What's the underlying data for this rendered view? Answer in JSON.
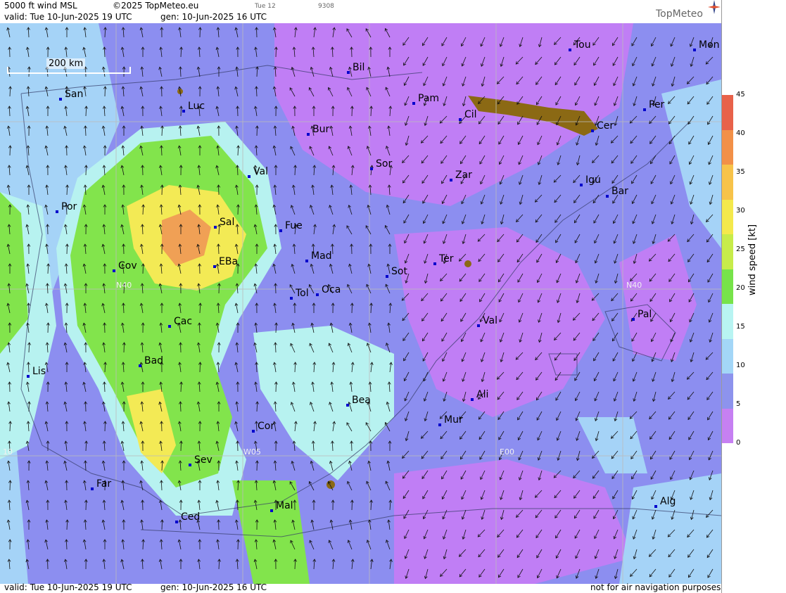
{
  "header": {
    "product": "5000 ft wind MSL",
    "copyright": "©2025 TopMeteo.eu",
    "valid": "valid:  Tue  10-Jun-2025  19 UTC",
    "gen": "gen: 10-Jun-2025 16 UTC",
    "day_tag": "Tue 12",
    "code": "9308",
    "logo": "TopMeteo"
  },
  "footer": {
    "valid": "valid:  Tue  10-Jun-2025  19 UTC",
    "gen": "gen: 10-Jun-2025 16 UTC",
    "disclaimer": "not for air navigation purposes"
  },
  "scale": {
    "label": "200 km"
  },
  "grid_labels": {
    "n40_west": "N40",
    "n40_east": "N40",
    "w05": "W05",
    "e00": "E00",
    "w10": "10"
  },
  "cities": [
    {
      "name": "San"
    },
    {
      "name": "Luc"
    },
    {
      "name": "Bil"
    },
    {
      "name": "Pam"
    },
    {
      "name": "Cil"
    },
    {
      "name": "Tou"
    },
    {
      "name": "Mon"
    },
    {
      "name": "Per"
    },
    {
      "name": "Cer"
    },
    {
      "name": "Bur"
    },
    {
      "name": "Sor"
    },
    {
      "name": "Zar"
    },
    {
      "name": "Igu"
    },
    {
      "name": "Bar"
    },
    {
      "name": "Val"
    },
    {
      "name": "Por"
    },
    {
      "name": "Sal"
    },
    {
      "name": "Fue"
    },
    {
      "name": "Cov"
    },
    {
      "name": "EBa"
    },
    {
      "name": "Mad"
    },
    {
      "name": "Sot"
    },
    {
      "name": "Ter"
    },
    {
      "name": "Tol"
    },
    {
      "name": "Oca"
    },
    {
      "name": "Pal"
    },
    {
      "name": "Cac"
    },
    {
      "name": "Val"
    },
    {
      "name": "Bad"
    },
    {
      "name": "Lis"
    },
    {
      "name": "Bea"
    },
    {
      "name": "Ali"
    },
    {
      "name": "Mur"
    },
    {
      "name": "Cor"
    },
    {
      "name": "Sev"
    },
    {
      "name": "Far"
    },
    {
      "name": "Mal"
    },
    {
      "name": "Alg"
    },
    {
      "name": "Ced"
    }
  ],
  "legend": {
    "unit": "wind speed [kt]",
    "ticks": [
      "45",
      "40",
      "35",
      "30",
      "25",
      "20",
      "15",
      "10",
      "5",
      "0"
    ],
    "colors": [
      "#e8624a",
      "#f29048",
      "#f7c34a",
      "#f4e94c",
      "#c7ec4a",
      "#77e34a",
      "#b8f4f2",
      "#a3d6f7",
      "#8d93ed",
      "#c680f2"
    ]
  },
  "colors": {
    "calm": "#c07ef5",
    "light": "#8c8ef0",
    "moderate": "#a5d3f7",
    "fresh": "#b7f2f0",
    "strong": "#82e44c",
    "very_strong": "#f3ea55",
    "gale": "#f0a055",
    "terrain": "#8b6914",
    "station": "#0000cc"
  }
}
